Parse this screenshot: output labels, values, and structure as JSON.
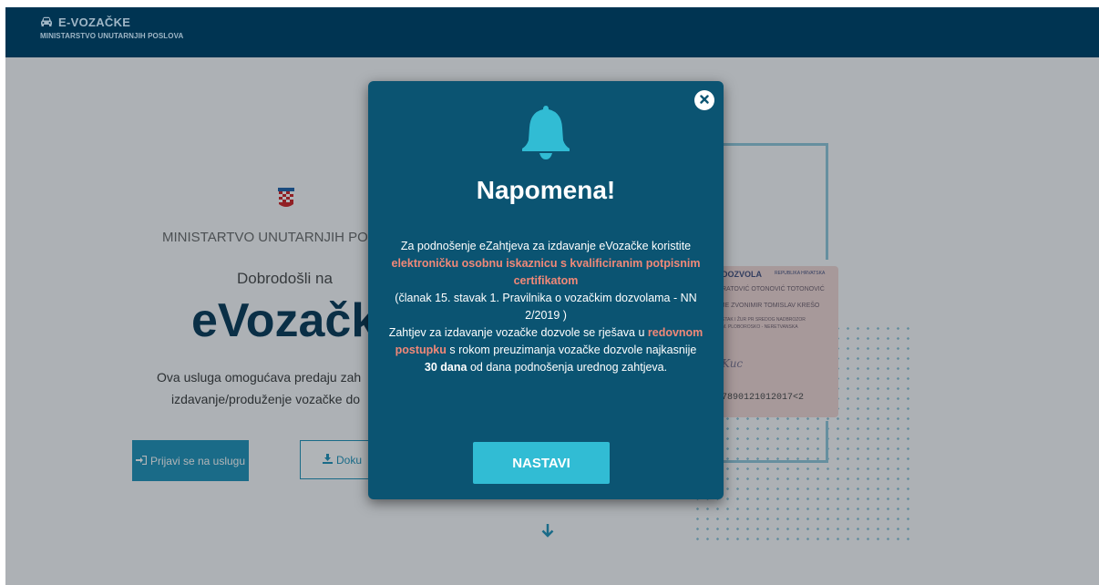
{
  "header": {
    "title": "E-VOZAČKE",
    "subtitle": "MINISTARSTVO UNUTARNJIH POSLOVA",
    "logo_icon": "car-icon"
  },
  "hero": {
    "ministry": "MINISTARTVO UNUTARNJIH PO",
    "welcome": "Dobrodošli na",
    "title": "eVozačke",
    "desc_line1": "Ova usluga omogućava predaju zah",
    "desc_line2": "izdavanje/produženje vozačke do",
    "login_button": "Prijavi se na uslugu",
    "documents_button": "Doku"
  },
  "license_card": {
    "header_left": "DOZVOLA",
    "header_right": "REPUBLIKA HRVATSKA",
    "line1": "RATOVIĆ OTONOVIĆ TOTONOVIĆ",
    "line2": "JE ZVONIMIR TOMISLAV KREŠO",
    "line3": "ETAK I ŽUR PR SREDOG NADBROZOR",
    "line4": "M. PLOBOROSKO - NERETVANSKA",
    "signature": "Kuc",
    "mrz": "7890121012017<2"
  },
  "modal": {
    "title": "Napomena!",
    "t1": "Za podnošenje eZahtjeva za izdavanje eVozačke koristite ",
    "h1": "elektroničku osobnu iskaznicu s kvalificiranim potpisnim certifikatom",
    "t2": "(članak 15. stavak 1. Pravilnika o vozačkim dozvolama - NN 2/2019 )",
    "t3": "Zahtjev za izdavanje vozačke dozvole se rješava u ",
    "h2": "redovnom postupku",
    "t4": " s rokom preuzimanja vozačke dozvole najkasnije ",
    "b1": "30 dana",
    "t5": " od dana podnošenja urednog zahtjeva.",
    "continue_button": "NASTAVI"
  },
  "colors": {
    "header_bg": "#003452",
    "modal_bg": "#0b5472",
    "highlight": "#f08878",
    "button": "#31bcd4"
  }
}
